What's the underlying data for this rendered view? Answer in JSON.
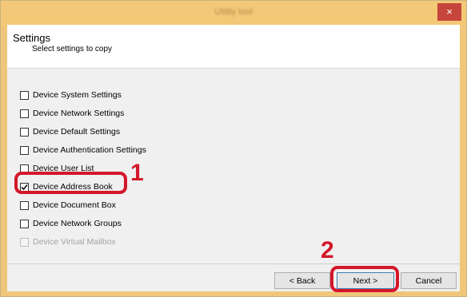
{
  "window": {
    "title": "Utility tool",
    "close_glyph": "×"
  },
  "header": {
    "title": "Settings",
    "subtitle": "Select settings to copy"
  },
  "options": [
    {
      "label": "Device System Settings",
      "checked": false,
      "enabled": true
    },
    {
      "label": "Device Network Settings",
      "checked": false,
      "enabled": true
    },
    {
      "label": "Device Default Settings",
      "checked": false,
      "enabled": true
    },
    {
      "label": "Device Authentication Settings",
      "checked": false,
      "enabled": true
    },
    {
      "label": "Device User List",
      "checked": false,
      "enabled": true
    },
    {
      "label": "Device Address Book",
      "checked": true,
      "enabled": true
    },
    {
      "label": "Device Document Box",
      "checked": false,
      "enabled": true
    },
    {
      "label": "Device Network Groups",
      "checked": false,
      "enabled": true
    },
    {
      "label": "Device Virtual Mailbox",
      "checked": false,
      "enabled": false
    }
  ],
  "buttons": {
    "back": "< Back",
    "next": "Next >",
    "cancel": "Cancel"
  },
  "callouts": {
    "one": "1",
    "two": "2"
  },
  "colors": {
    "highlight": "#d4172a",
    "titlebar": "#f3c877"
  }
}
